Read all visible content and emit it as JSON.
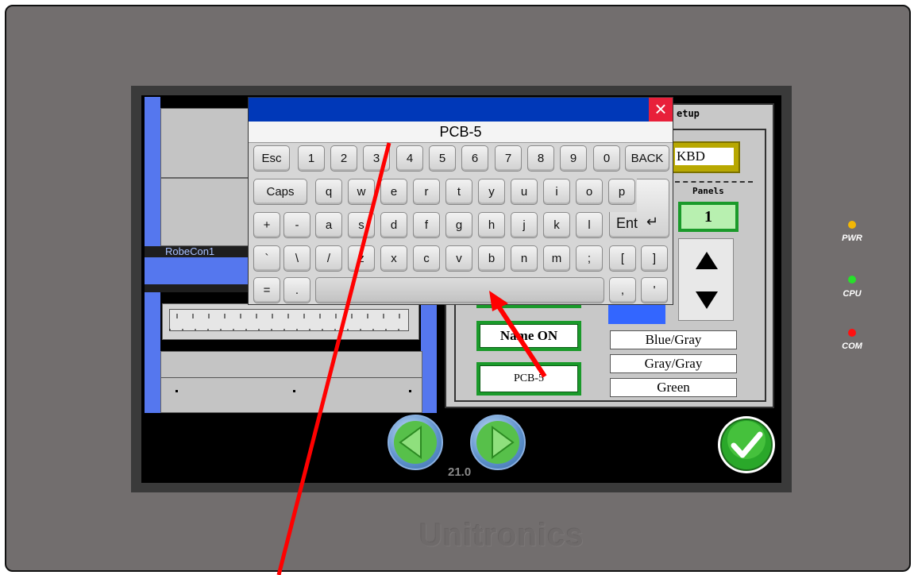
{
  "device": {
    "brand": "Unitronics",
    "leds": [
      {
        "label": "PWR",
        "color": "#f2b705"
      },
      {
        "label": "CPU",
        "color": "#27e02b"
      },
      {
        "label": "COM",
        "color": "#ff1010"
      }
    ]
  },
  "machine": {
    "station_label": "RobeCon1"
  },
  "setup_panel": {
    "title": "etup",
    "kbd_button": "KBD",
    "panels_label": "Panels",
    "panels_value": "1",
    "name_button": "Name ON",
    "name_field": "PCB-5",
    "color_options": [
      "Blue/Gray",
      "Gray/Gray",
      "Green"
    ]
  },
  "keyboard": {
    "input_value": "PCB-5",
    "close_icon": "close-icon",
    "rows": [
      [
        "Esc",
        "1",
        "2",
        "3",
        "4",
        "5",
        "6",
        "7",
        "8",
        "9",
        "0",
        "BACK"
      ],
      [
        "Caps",
        "q",
        "w",
        "e",
        "r",
        "t",
        "y",
        "u",
        "i",
        "o",
        "p"
      ],
      [
        "+",
        "-",
        "a",
        "s",
        "d",
        "f",
        "g",
        "h",
        "j",
        "k",
        "l",
        "Ent"
      ],
      [
        "`",
        "\\",
        "/",
        "z",
        "x",
        "c",
        "v",
        "b",
        "n",
        "m",
        ";",
        "[",
        "]"
      ],
      [
        "=",
        ".",
        ",",
        "'"
      ]
    ]
  },
  "navigation": {
    "version": "21.0",
    "prev_icon": "left-arrow-icon",
    "next_icon": "right-arrow-icon",
    "confirm_icon": "checkmark-icon"
  },
  "colors": {
    "title_bar": "#0038b8",
    "accent_green": "#1a9a2a",
    "annotation_red": "#ff0000"
  }
}
